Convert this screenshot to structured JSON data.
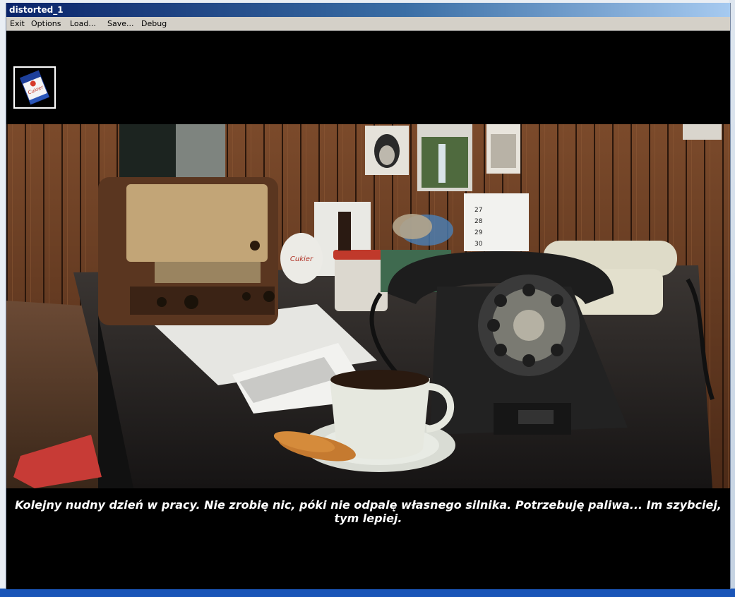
{
  "window": {
    "title": "distorted_1"
  },
  "menu": {
    "items": [
      "Exit",
      "Options",
      "Load...",
      "Save...",
      "Debug"
    ]
  },
  "inventory": {
    "items": [
      {
        "name": "sugar-packet-icon",
        "label": "Cukier"
      }
    ]
  },
  "scene": {
    "radio_label": "radio-icon",
    "calendar_numbers": [
      "27",
      "28",
      "29",
      "30"
    ],
    "sugar_label": "Cukier"
  },
  "dialogue": {
    "text": "Kolejny nudny dzień w pracy. Nie zrobię nic, póki nie odpalę własnego silnika. Potrzebuję paliwa... Im szybciej, tym lepiej."
  },
  "colors": {
    "title_gradient_start": "#0a246a",
    "title_gradient_end": "#a6caf0",
    "menu_bg": "#d4d0c8",
    "game_bg": "#000000",
    "caption_text": "#ffffff"
  }
}
